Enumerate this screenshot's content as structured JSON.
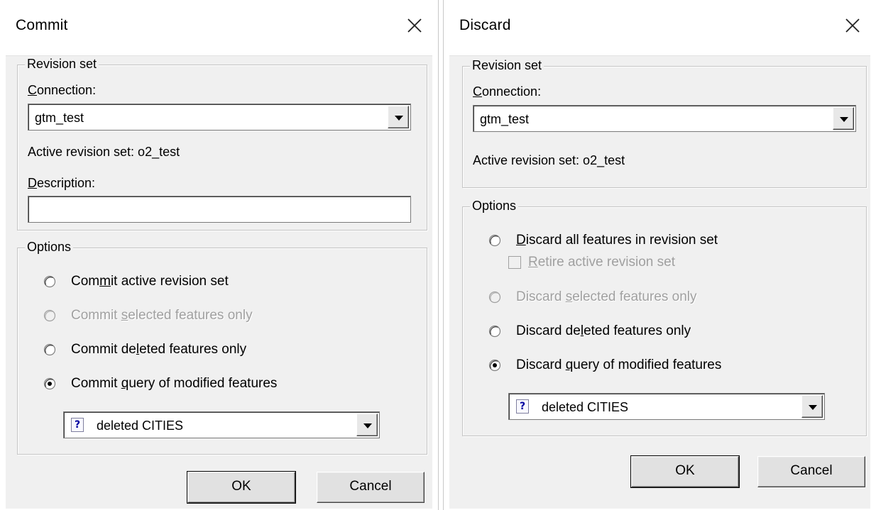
{
  "commit": {
    "title": "Commit",
    "revision_group": "Revision set",
    "connection_label": "Connection:",
    "connection_value": "gtm_test",
    "active_label": "Active revision set: o2_test",
    "description_label": "Description:",
    "description_value": "",
    "options_group": "Options",
    "options": [
      {
        "label": "Commit active revision set",
        "selected": false,
        "enabled": true
      },
      {
        "label": "Commit selected features only",
        "selected": false,
        "enabled": false
      },
      {
        "label": "Commit deleted features only",
        "selected": false,
        "enabled": true
      },
      {
        "label": "Commit query of modified features",
        "selected": true,
        "enabled": true
      }
    ],
    "query_value": "deleted CITIES",
    "ok": "OK",
    "cancel": "Cancel"
  },
  "discard": {
    "title": "Discard",
    "revision_group": "Revision set",
    "connection_label": "Connection:",
    "connection_value": "gtm_test",
    "active_label": "Active revision set:  o2_test",
    "options_group": "Options",
    "options": [
      {
        "label": "Discard all features in revision set",
        "selected": false,
        "enabled": true
      },
      {
        "label": "Discard selected features only",
        "selected": false,
        "enabled": false
      },
      {
        "label": "Discard deleted features only",
        "selected": false,
        "enabled": true
      },
      {
        "label": "Discard query of modified features",
        "selected": true,
        "enabled": true
      }
    ],
    "retire_label": "Retire active revision set",
    "retire_checked": false,
    "query_value": "deleted CITIES",
    "ok": "OK",
    "cancel": "Cancel"
  },
  "icons": {
    "close": "close-icon",
    "dropdown": "chevron-down-icon",
    "query": "query-icon"
  }
}
